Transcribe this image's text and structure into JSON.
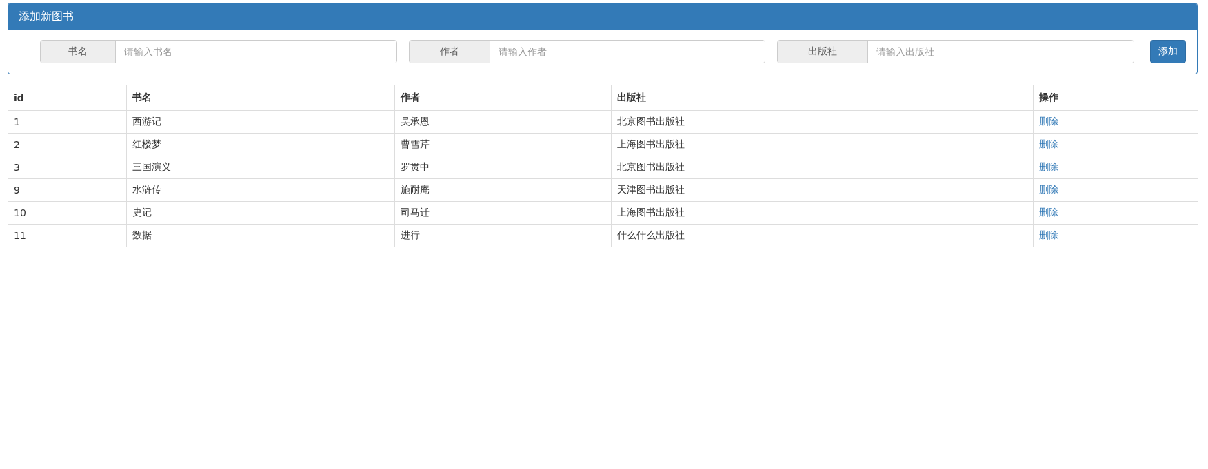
{
  "panel": {
    "title": "添加新图书"
  },
  "form": {
    "fields": [
      {
        "label": "书名",
        "placeholder": "请输入书名"
      },
      {
        "label": "作者",
        "placeholder": "请输入作者"
      },
      {
        "label": "出版社",
        "placeholder": "请输入出版社"
      }
    ],
    "button": "添加"
  },
  "table": {
    "columns": [
      "id",
      "书名",
      "作者",
      "出版社",
      "操作"
    ],
    "rows": [
      [
        "1",
        "西游记",
        "吴承恩",
        "北京图书出版社",
        "删除"
      ],
      [
        "2",
        "红楼梦",
        "曹雪芹",
        "上海图书出版社",
        "删除"
      ],
      [
        "3",
        "三国演义",
        "罗贯中",
        "北京图书出版社",
        "删除"
      ],
      [
        "9",
        "水浒传",
        "施耐庵",
        "天津图书出版社",
        "删除"
      ],
      [
        "10",
        "史记",
        "司马迁",
        "上海图书出版社",
        "删除"
      ],
      [
        "11",
        "数据",
        "进行",
        "什么什么出版社",
        "删除"
      ]
    ]
  }
}
